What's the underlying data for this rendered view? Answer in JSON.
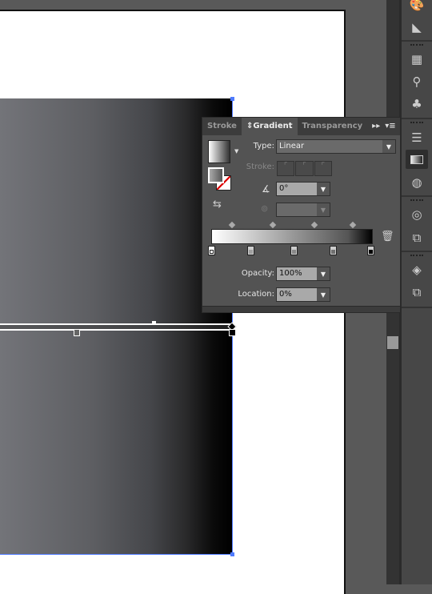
{
  "panel": {
    "tabs": [
      {
        "label": "Stroke"
      },
      {
        "label": "Gradient",
        "active": true
      },
      {
        "label": "Transparency"
      }
    ],
    "type_label": "Type:",
    "type_value": "Linear",
    "stroke_label": "Stroke:",
    "angle_value": "0°",
    "aspect_value": "",
    "opacity_label": "Opacity:",
    "opacity_value": "100%",
    "location_label": "Location:",
    "location_value": "0%",
    "stops": [
      "#ffffff",
      "#a0a0a0",
      "#888888",
      "#707070",
      "#000000"
    ],
    "selected_stop": 0
  },
  "toolbar": {
    "icons": [
      "color-guide-icon",
      "color-icon",
      "swatches-icon",
      "brushes-icon",
      "symbols-icon",
      "stroke-icon",
      "gradient-icon",
      "transparency-icon",
      "appearance-icon",
      "graphic-styles-icon",
      "layers-icon",
      "artboards-icon"
    ],
    "active": "gradient-icon"
  },
  "colors": {
    "accent": "#4f7bff",
    "panel": "#535353",
    "toolbar": "#474747"
  }
}
